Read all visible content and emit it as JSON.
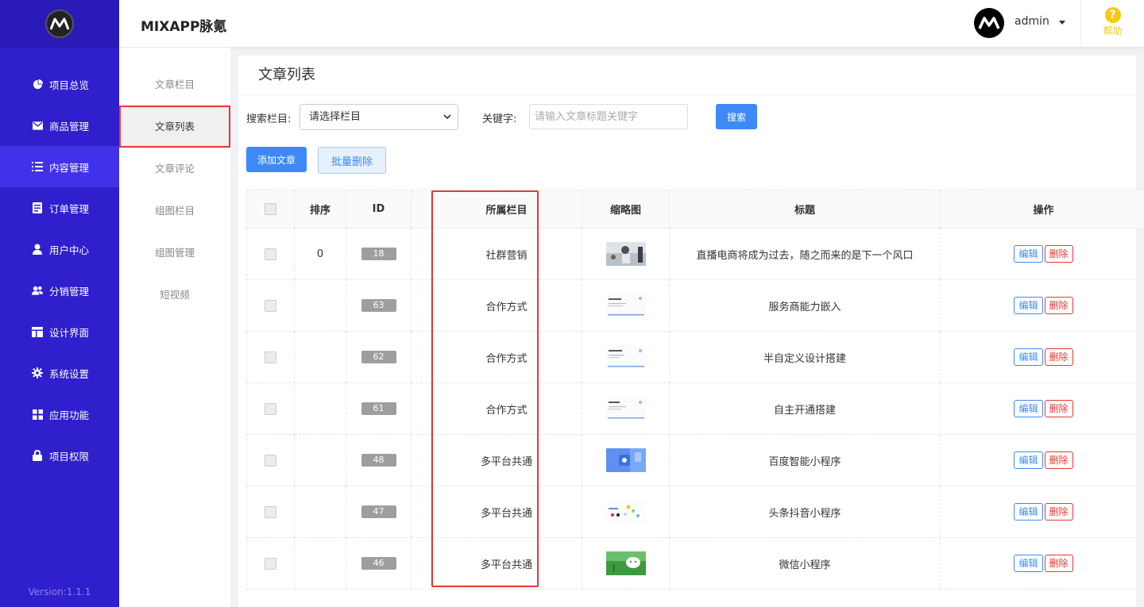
{
  "app": {
    "title": "MIXAPP脉氪"
  },
  "sidebar": {
    "items": [
      {
        "label": "项目总览",
        "icon": "pie-chart-icon"
      },
      {
        "label": "商品管理",
        "icon": "envelope-icon"
      },
      {
        "label": "内容管理",
        "icon": "list-icon",
        "active": true
      },
      {
        "label": "订单管理",
        "icon": "document-icon"
      },
      {
        "label": "用户中心",
        "icon": "user-icon"
      },
      {
        "label": "分销管理",
        "icon": "users-icon"
      },
      {
        "label": "设计界面",
        "icon": "layout-icon"
      },
      {
        "label": "系统设置",
        "icon": "gear-icon"
      },
      {
        "label": "应用功能",
        "icon": "grid-icon"
      },
      {
        "label": "项目权限",
        "icon": "lock-icon"
      }
    ],
    "version": "Version:1.1.1"
  },
  "header": {
    "username": "admin",
    "help_label": "帮助",
    "help_glyph": "?"
  },
  "submenu": {
    "items": [
      {
        "label": "文章栏目"
      },
      {
        "label": "文章列表",
        "active": true
      },
      {
        "label": "文章评论"
      },
      {
        "label": "组图栏目"
      },
      {
        "label": "组图管理"
      },
      {
        "label": "短视频"
      }
    ]
  },
  "main": {
    "title": "文章列表",
    "filters": {
      "category_label": "搜索栏目:",
      "category_value": "请选择栏目",
      "keyword_label": "关键字:",
      "keyword_placeholder": "请输入文章标题关键字",
      "search_label": "搜索"
    },
    "actions": {
      "add_label": "添加文章",
      "batch_delete_label": "批量删除"
    },
    "table": {
      "headers": {
        "sort": "排序",
        "id": "ID",
        "category": "所属栏目",
        "thumb": "缩略图",
        "title": "标题",
        "ops": "操作"
      },
      "edit_label": "编辑",
      "delete_label": "删除",
      "rows": [
        {
          "sort": "0",
          "id": "18",
          "category": "社群营销",
          "title": "直播电商将成为过去，随之而来的是下一个风口"
        },
        {
          "sort": "",
          "id": "63",
          "category": "合作方式",
          "title": "服务商能力嵌入"
        },
        {
          "sort": "",
          "id": "62",
          "category": "合作方式",
          "title": "半自定义设计搭建"
        },
        {
          "sort": "",
          "id": "61",
          "category": "合作方式",
          "title": "自主开通搭建"
        },
        {
          "sort": "",
          "id": "48",
          "category": "多平台共通",
          "title": "百度智能小程序"
        },
        {
          "sort": "",
          "id": "47",
          "category": "多平台共通",
          "title": "头条抖音小程序"
        },
        {
          "sort": "",
          "id": "46",
          "category": "多平台共通",
          "title": "微信小程序"
        }
      ]
    }
  },
  "colors": {
    "sidebar": "#2f1fcc",
    "active": "#4131e8",
    "primary": "#3d8af7",
    "danger": "#e53935",
    "help": "#f6c812"
  }
}
